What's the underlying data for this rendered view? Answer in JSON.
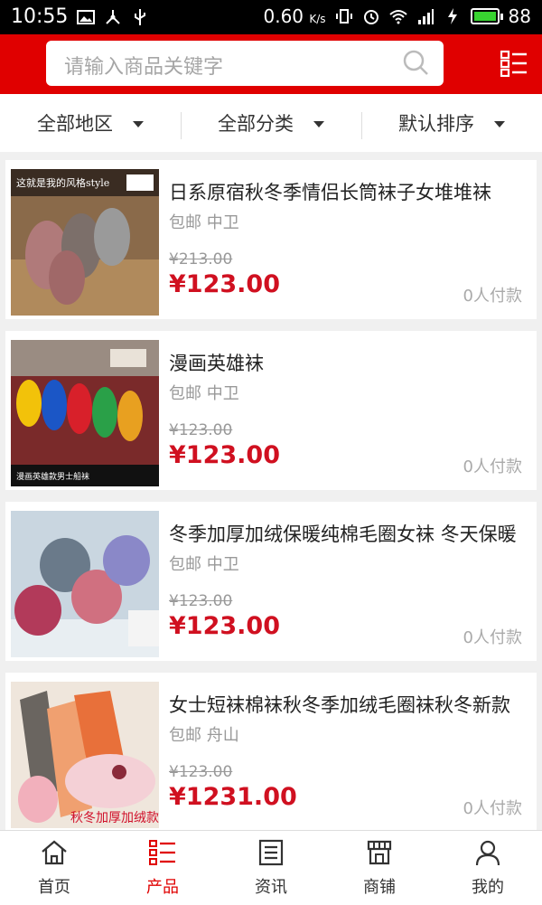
{
  "status": {
    "time": "10:55",
    "speed": "0.60",
    "speed_unit": "K/s",
    "battery": "88"
  },
  "search": {
    "placeholder": "请输入商品关键字"
  },
  "filters": [
    {
      "label": "全部地区"
    },
    {
      "label": "全部分类"
    },
    {
      "label": "默认排序"
    }
  ],
  "products": [
    {
      "title": "日系原宿秋冬季情侣长筒袜子女堆堆袜",
      "shipping": "包邮 中卫",
      "old_price": "¥213.00",
      "price": "¥123.00",
      "paid": "0人付款",
      "thumb_caption": "这就是我的风格style"
    },
    {
      "title": "漫画英雄袜",
      "shipping": "包邮 中卫",
      "old_price": "¥123.00",
      "price": "¥123.00",
      "paid": "0人付款",
      "thumb_caption": "漫画英雄款男士船袜"
    },
    {
      "title": "冬季加厚加绒保暖纯棉毛圈女袜 冬天保暖",
      "shipping": "包邮 中卫",
      "old_price": "¥123.00",
      "price": "¥123.00",
      "paid": "0人付款",
      "thumb_caption": ""
    },
    {
      "title": "女士短袜棉袜秋冬季加绒毛圈袜秋冬新款",
      "shipping": "包邮 舟山",
      "old_price": "¥123.00",
      "price": "¥1231.00",
      "paid": "0人付款",
      "thumb_caption": "秋冬加厚加绒款"
    }
  ],
  "tabs": [
    {
      "label": "首页",
      "icon": "home-icon"
    },
    {
      "label": "产品",
      "icon": "list-icon"
    },
    {
      "label": "资讯",
      "icon": "news-icon"
    },
    {
      "label": "商铺",
      "icon": "shop-icon"
    },
    {
      "label": "我的",
      "icon": "user-icon"
    }
  ],
  "colors": {
    "brand": "#e00000",
    "price": "#d01020"
  }
}
